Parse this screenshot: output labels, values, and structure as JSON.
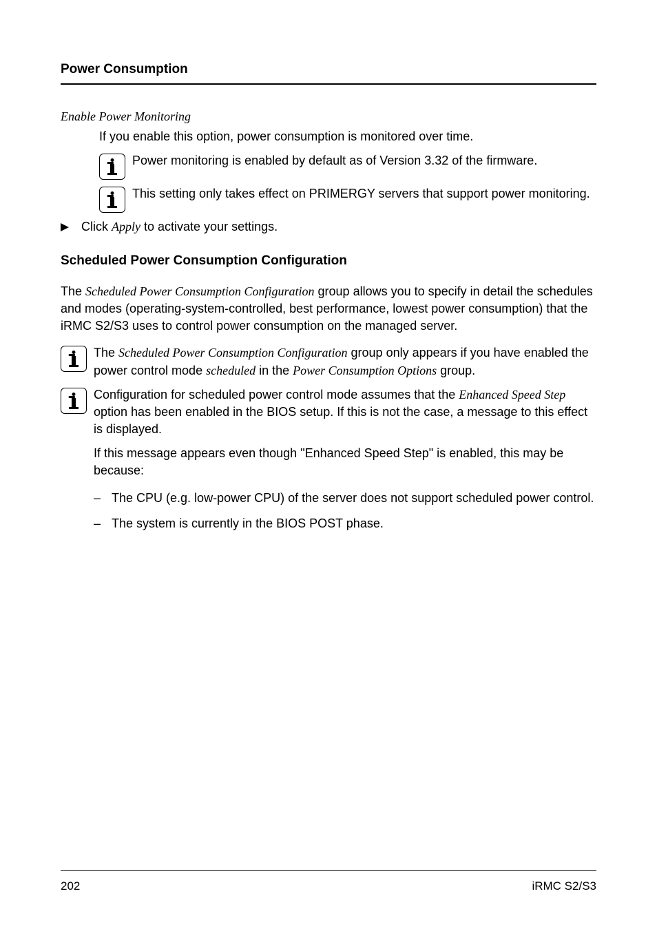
{
  "header": {
    "section_title": "Power Consumption"
  },
  "option": {
    "title": "Enable Power Monitoring",
    "desc": "If you enable this option, power consumption is monitored over time.",
    "note1": "Power monitoring is enabled by default as of Version 3.32 of the firmware.",
    "note2": "This setting only takes effect on PRIMERGY servers that support power monitoring."
  },
  "apply": {
    "prefix": "Click ",
    "action": "Apply",
    "suffix": " to activate your settings."
  },
  "sched": {
    "heading": "Scheduled Power Consumption Configuration",
    "intro_prefix": "The ",
    "intro_italic": "Scheduled Power Consumption Configuration",
    "intro_suffix": " group allows you to specify in detail the schedules and modes (operating-system-controlled, best performance, lowest power consumption) that the iRMC S2/S3 uses to control power consumption on the managed server.",
    "note_a_prefix": "The ",
    "note_a_italic1": "Scheduled Power Consumption Configuration",
    "note_a_mid1": " group only appears if you have enabled the power control mode ",
    "note_a_italic2": "scheduled",
    "note_a_mid2": " in the ",
    "note_a_italic3": "Power Consumption Options",
    "note_a_suffix": " group.",
    "note_b_prefix": "Configuration for scheduled power control mode assumes that the ",
    "note_b_italic": "Enhanced Speed Step",
    "note_b_suffix": " option has been enabled in the BIOS setup. If this is not the case, a message to this effect is displayed.",
    "continued": "If this message appears even though \"Enhanced Speed Step\" is enabled, this may be because:",
    "dash1": "The CPU (e.g. low-power CPU) of the server does not support scheduled power control.",
    "dash2": "The system is currently in the BIOS POST phase."
  },
  "footer": {
    "page": "202",
    "doc": "iRMC S2/S3"
  }
}
